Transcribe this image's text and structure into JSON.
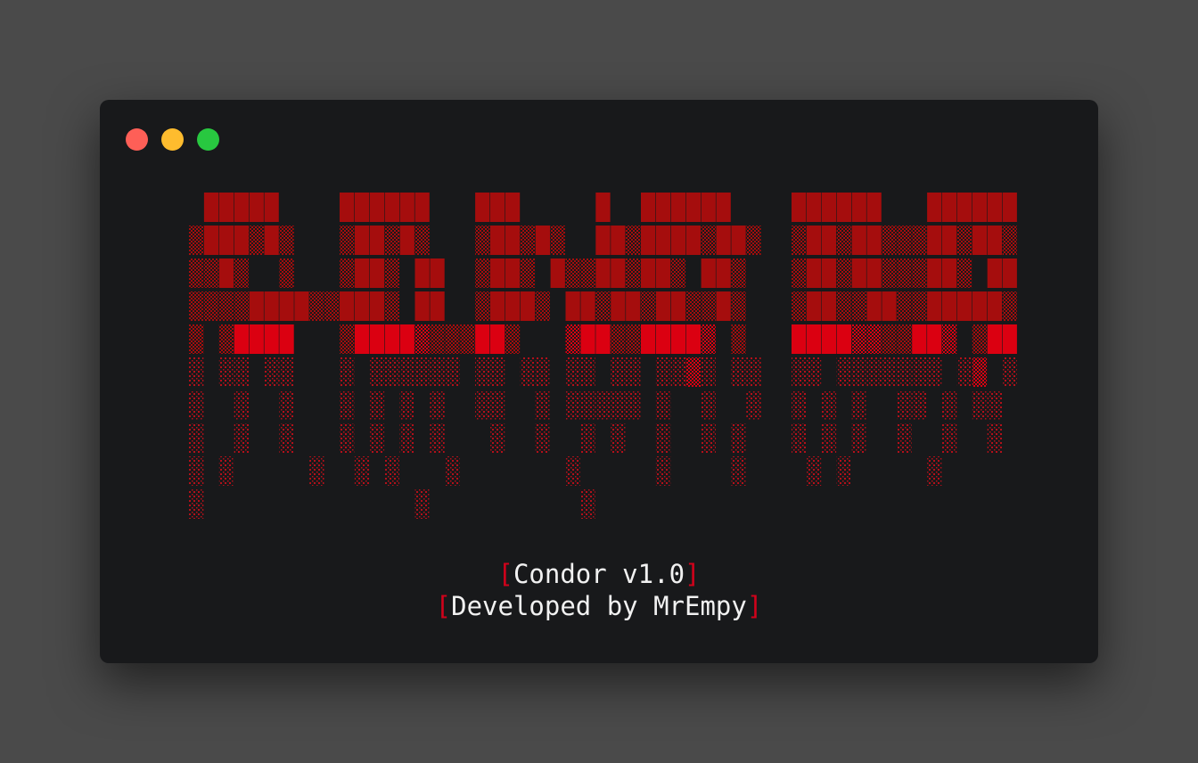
{
  "window": {
    "controls": [
      {
        "name": "close-button",
        "color": "#fe5f57"
      },
      {
        "name": "minimize-button",
        "color": "#febc2e"
      },
      {
        "name": "maximize-button",
        "color": "#28c840"
      }
    ]
  },
  "banner": {
    "logo_text": "CONDOR",
    "colors": {
      "dark": "#a50d0d",
      "bright": "#db0011",
      "background": "#18191b"
    }
  },
  "credits": {
    "bracket_open": "[",
    "bracket_close": "]",
    "version_line": "Condor v1.0",
    "author_line": "Developed by MrEmpy"
  }
}
